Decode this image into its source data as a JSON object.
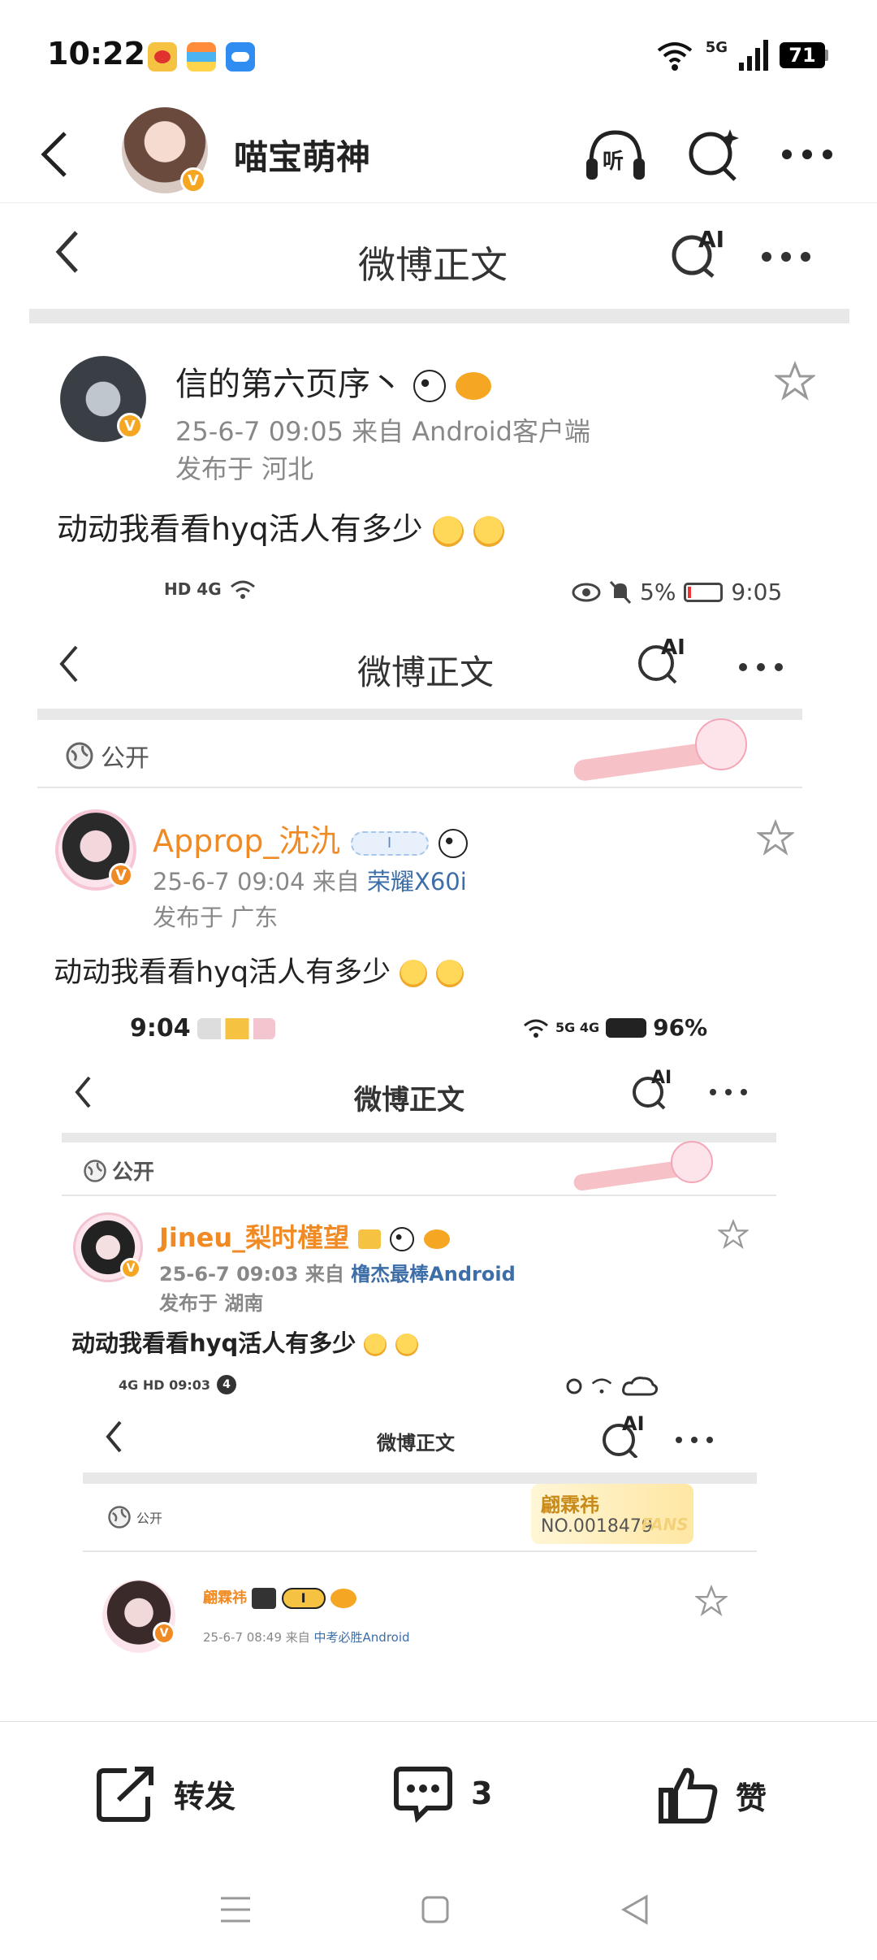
{
  "status_bar": {
    "time": "10:22",
    "network": "5G",
    "battery": "71",
    "app_icons": [
      "weibo-icon",
      "wallet-icon",
      "cloud-icon"
    ]
  },
  "header": {
    "title": "喵宝萌神",
    "verified_badge": "V",
    "icons": [
      "listen-headphones-icon",
      "ai-search-icon",
      "more-icon"
    ],
    "listen_label": "听"
  },
  "colors": {
    "accent_orange": "#f08a24",
    "verified": "#f5a623",
    "link_blue": "#3e6ea8",
    "meta_gray": "#888888"
  },
  "screenshot": {
    "level1": {
      "nav_title": "微博正文",
      "ai_label": "AI",
      "author": "信的第六页序丶",
      "meta": "25-6-7 09:05  来自 Android客户端",
      "location": "发布于 河北",
      "text": "动动我看看hyq活人有多少",
      "status_bar": {
        "indicators": "HD 4G",
        "battery": "5%",
        "time": "9:05"
      }
    },
    "level2": {
      "nav_title": "微博正文",
      "ai_label": "AI",
      "public": "公开",
      "author": "Approp_沈氿",
      "meta_prefix": "25-6-7 09:04   来自 ",
      "meta_source": "荣耀X60i",
      "location": "发布于 广东",
      "text": "动动我看看hyq活人有多少",
      "badge_label": "I",
      "status_bar": {
        "time": "9:04",
        "network": "5G 4G",
        "battery": "96%"
      }
    },
    "level3": {
      "nav_title": "微博正文",
      "ai_label": "AI",
      "public": "公开",
      "author": "Jineu_梨时槿望",
      "meta_prefix": "25-6-7 09:03  来自 ",
      "meta_source": "橹杰最棒Android",
      "location": "发布于 湖南",
      "text": "动动我看看hyq活人有多少",
      "status_bar": {
        "left": "4G  HD  09:03",
        "badge": "4"
      }
    },
    "level4": {
      "nav_title": "微博正文",
      "ai_label": "AI",
      "public": "公开",
      "fan_badge_name": "翩霖祎",
      "fan_badge_no": "NO.0018479",
      "fans_label": "FANS",
      "author": "翩霖祎",
      "badge_label": "I",
      "meta_prefix": "25-6-7  08:49   来自 ",
      "meta_source": "中考必胜Android"
    }
  },
  "actions": {
    "repost": "转发",
    "comments": "3",
    "like": "赞"
  },
  "nav": {
    "icons": [
      "menu-icon",
      "home-square-icon",
      "back-triangle-icon"
    ]
  }
}
